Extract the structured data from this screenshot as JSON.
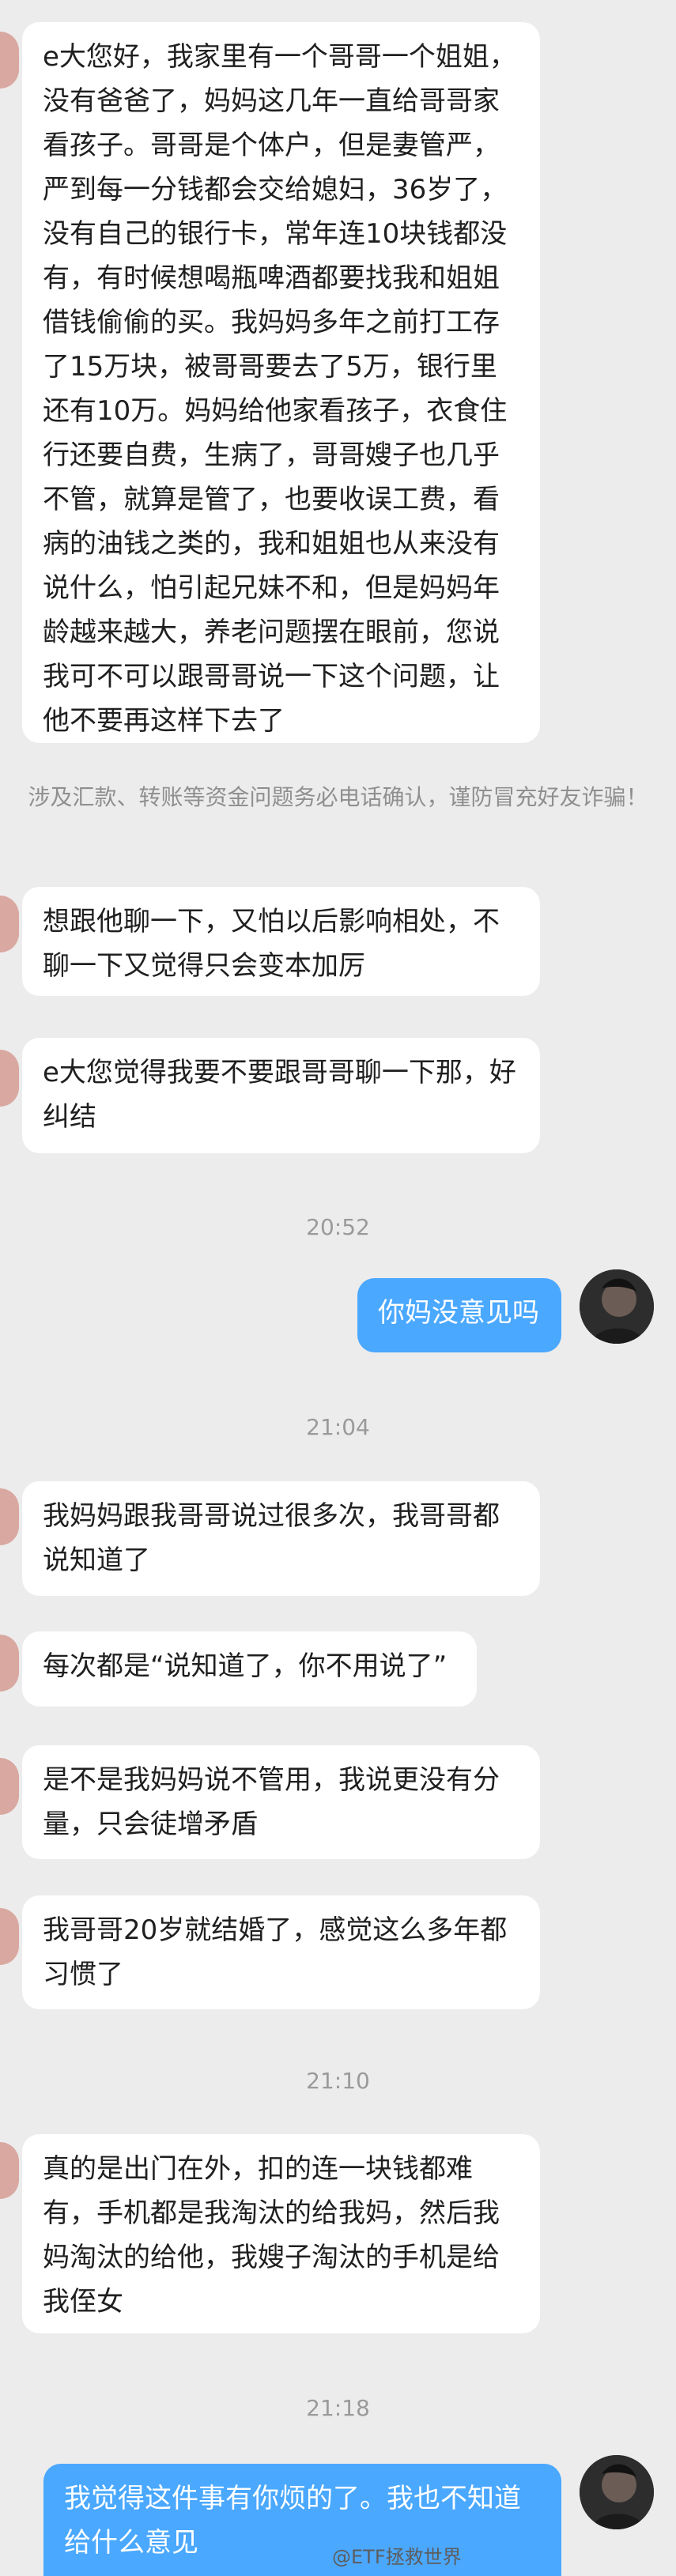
{
  "messages": [
    {
      "text": "e大您好，我家里有一个哥哥一个姐姐，没有爸爸了，妈妈这几年一直给哥哥家看孩子。哥哥是个体户，但是妻管严，严到每一分钱都会交给媳妇，36岁了，没有自己的银行卡，常年连10块钱都没有，有时候想喝瓶啤酒都要找我和姐姐借钱偷偷的买。我妈妈多年之前打工存了15万块，被哥哥要去了5万，银行里还有10万。妈妈给他家看孩子，衣食住行还要自费，生病了，哥哥嫂子也几乎不管，就算是管了，也要收误工费，看病的油钱之类的，我和姐姐也从来没有说什么，怕引起兄妹不和，但是妈妈年龄越来越大，养老问题摆在眼前，您说我可不可以跟哥哥说一下这个问题，让他不要再这样下去了"
    },
    {
      "text": "想跟他聊一下，又怕以后影响相处，不聊一下又觉得只会变本加厉"
    },
    {
      "text": "e大您觉得我要不要跟哥哥聊一下那，好纠结"
    },
    {
      "text": "你妈没意见吗"
    },
    {
      "text": "我妈妈跟我哥哥说过很多次，我哥哥都说知道了"
    },
    {
      "text": "每次都是“说知道了，你不用说了”"
    },
    {
      "text": "是不是我妈妈说不管用，我说更没有分量，只会徒增矛盾"
    },
    {
      "text": "我哥哥20岁就结婚了，感觉这么多年都习惯了"
    },
    {
      "text": "真的是出门在外，扣的连一块钱都难有，手机都是我淘汰的给我妈，然后我妈淘汰的给他，我嫂子淘汰的手机是给我侄女"
    },
    {
      "text": "我觉得这件事有你烦的了。我也不知道给什么意见"
    }
  ],
  "notice": "涉及汇款、转账等资金问题务必电话确认，谨防冒充好友诈骗！",
  "times": {
    "t1": "20:52",
    "t2": "21:04",
    "t3": "21:10",
    "t4": "21:18"
  },
  "watermark": "@ETF拯救世界"
}
